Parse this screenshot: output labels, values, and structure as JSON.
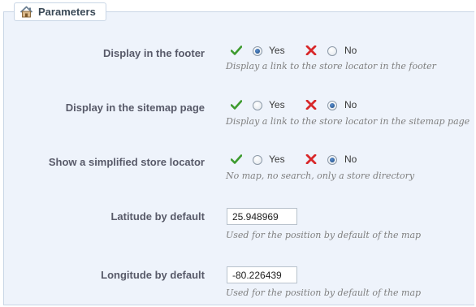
{
  "panel": {
    "legend_title": "Parameters",
    "legend_icon": "home-icon"
  },
  "colors": {
    "panel_background": "#eef3fb",
    "check_green": "#3e9b2f",
    "cross_red": "#d8282a",
    "label_text": "#585a69",
    "help_text": "#7f7f7f"
  },
  "options": {
    "yes_label": "Yes",
    "no_label": "No"
  },
  "settings": [
    {
      "label": "Display in the footer",
      "selected": "Yes",
      "help": "Display a link to the store locator in the footer"
    },
    {
      "label": "Display in the sitemap page",
      "selected": "No",
      "help": "Display a link to the store locator in the sitemap page"
    },
    {
      "label": "Show a simplified store locator",
      "selected": "No",
      "help": "No map, no search, only a store directory"
    }
  ],
  "fields": [
    {
      "label": "Latitude by default",
      "value": "25.948969",
      "help": "Used for the position by default of the map"
    },
    {
      "label": "Longitude by default",
      "value": "-80.226439",
      "help": "Used for the position by default of the map"
    }
  ]
}
